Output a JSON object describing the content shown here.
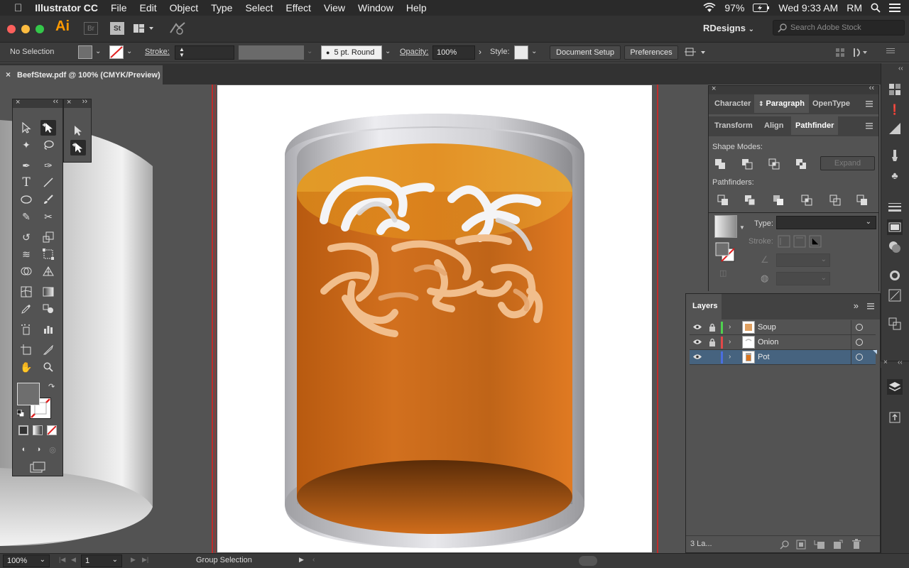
{
  "menubar": {
    "app_name": "Illustrator CC",
    "menus": [
      "File",
      "Edit",
      "Object",
      "Type",
      "Select",
      "Effect",
      "View",
      "Window",
      "Help"
    ],
    "battery": "97%",
    "clock": "Wed 9:33 AM",
    "user": "RM"
  },
  "appbar": {
    "logo": "Ai",
    "bridge": "Br",
    "stock": "St",
    "workspace": "RDesigns",
    "search_placeholder": "Search Adobe Stock"
  },
  "control": {
    "selection": "No Selection",
    "stroke_label": "Stroke:",
    "brush": "5 pt. Round",
    "opacity_label": "Opacity:",
    "opacity_value": "100%",
    "style_label": "Style:",
    "document_setup": "Document Setup",
    "preferences": "Preferences"
  },
  "document": {
    "tab_title": "BeefStew.pdf @ 100% (CMYK/Preview)"
  },
  "paragraph_panel": {
    "tabs": [
      "Character",
      "Paragraph",
      "OpenType"
    ],
    "active_tab": "Paragraph"
  },
  "pathfinder_panel": {
    "tabs": [
      "Transform",
      "Align",
      "Pathfinder"
    ],
    "active_tab": "Pathfinder",
    "shape_modes_label": "Shape Modes:",
    "expand_label": "Expand",
    "pathfinders_label": "Pathfinders:"
  },
  "gradient_panel": {
    "type_label": "Type:",
    "stroke_label": "Stroke:"
  },
  "layers_panel": {
    "title": "Layers",
    "layers": [
      {
        "name": "Soup",
        "color": "#4fd04f",
        "locked": true,
        "selected": false
      },
      {
        "name": "Onion",
        "color": "#e34848",
        "locked": true,
        "selected": false
      },
      {
        "name": "Pot",
        "color": "#4a6ee0",
        "locked": false,
        "selected": true
      }
    ],
    "footer_count": "3 La..."
  },
  "status": {
    "zoom": "100%",
    "artboard": "1",
    "mode": "Group Selection"
  },
  "colors": {
    "accent_selection": "#46637f",
    "soup_orange": "#d9741e",
    "bleed_red": "#c02b2b"
  }
}
